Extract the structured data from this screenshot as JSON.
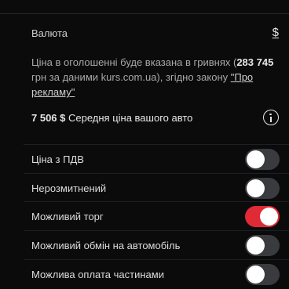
{
  "currency": {
    "label": "Валюта",
    "value": "$"
  },
  "note": {
    "prefix": "Ціна в оголошенні буде вказана в гривнях (",
    "amount": "283 745",
    "middle": " грн за даними kurs.com.ua), згідно закону ",
    "link": "\"Про рекламу\""
  },
  "average": {
    "value": "7 506 $",
    "label": " Середня ціна вашого авто"
  },
  "options": [
    {
      "label": "Ціна з ПДВ",
      "on": false
    },
    {
      "label": "Нерозмитнений",
      "on": false
    },
    {
      "label": "Можливий торг",
      "on": true
    },
    {
      "label": "Можливий обмін на автомобіль",
      "on": false
    },
    {
      "label": "Можлива оплата частинами",
      "on": false
    }
  ],
  "colors": {
    "accent": "#e02a36",
    "background": "#0b0b0c"
  },
  "icons": {
    "info": "info-icon"
  }
}
